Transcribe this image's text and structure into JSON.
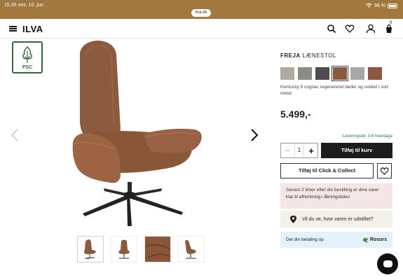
{
  "status": {
    "time": "15.35",
    "date": "ons. 10. jun.",
    "battery": "98 %",
    "url": "ilva.dk"
  },
  "header": {
    "logo": "ILVA",
    "cart_count": "0",
    "icons": [
      "menu-icon",
      "search-icon",
      "heart-icon",
      "user-icon",
      "cart-icon"
    ]
  },
  "gallery": {
    "badge": "FSC",
    "thumbnail_count": 4
  },
  "product": {
    "brand": "FREJA",
    "name": "LÆNESTOL",
    "description": "Kentucky 9 cognac regenereret læder og sokkel i sort metal",
    "price": "5.499,-",
    "swatch_colors": [
      "#b4a69a",
      "#8d8a86",
      "#4d4d4f",
      "#8a5a3e",
      "#a6a7a8",
      "#8c5640"
    ],
    "selected_swatch": 3,
    "delivery": "Leveringstid: 3-6 hverdage",
    "quantity": "1",
    "add_to_cart": "Tilføj til kurv",
    "click_collect": "Tilføj til Click & Collect",
    "notice": "Senest 2 timer efter din bestilling er dine varer klar til afhentning i åbningstiden",
    "store_link": "Vil du se, hvor varen er udstillet?",
    "payment_text": "Del din betaling op",
    "payment_provider": "Rosurs"
  }
}
